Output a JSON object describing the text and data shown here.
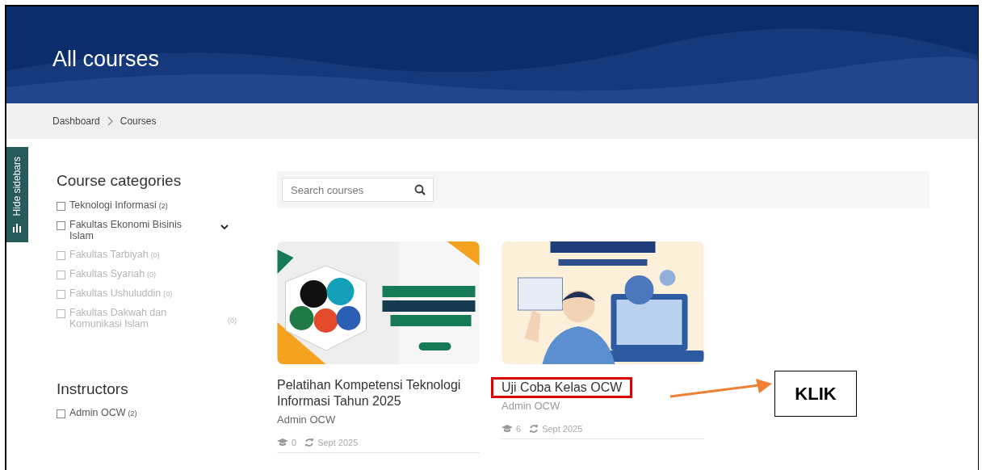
{
  "header": {
    "title": "All courses"
  },
  "breadcrumb": [
    "Dashboard",
    "Courses"
  ],
  "sidebar_toggle": {
    "label": "Hide sidebars"
  },
  "categories": {
    "title": "Course categories",
    "items": [
      {
        "label": "Teknologi Informasi",
        "count": "(2)",
        "checked": false,
        "disabled": false,
        "kind": "leaf"
      },
      {
        "label": "Fakultas Ekonomi Bisinis Islam",
        "checked": false,
        "disabled": false,
        "kind": "parent"
      },
      {
        "label": "Fakultas Tarbiyah",
        "count": "(0)",
        "checked": false,
        "disabled": true,
        "kind": "leaf"
      },
      {
        "label": "Fakultas Syariah",
        "count": "(0)",
        "checked": false,
        "disabled": true,
        "kind": "leaf"
      },
      {
        "label": "Fakultas Ushuluddin",
        "count": "(0)",
        "checked": false,
        "disabled": true,
        "kind": "leaf"
      },
      {
        "label": "Fakultas Dakwah dan Komunikasi Islam",
        "count": "(0)",
        "checked": false,
        "disabled": true,
        "kind": "wide"
      }
    ]
  },
  "instructors": {
    "title": "Instructors",
    "items": [
      {
        "label": "Admin OCW",
        "count": "(2)",
        "checked": false
      }
    ]
  },
  "search": {
    "placeholder": "Search courses"
  },
  "courses": [
    {
      "title": "Pelatihan Kompetensi Teknologi Informasi Tahun 2025",
      "instructor": "Admin OCW",
      "students": "0",
      "updated": "Sept 2025",
      "highlighted": false
    },
    {
      "title": "Uji Coba Kelas OCW",
      "instructor": "Admin OCW",
      "students": "6",
      "updated": "Sept 2025",
      "highlighted": true
    }
  ],
  "annotation": {
    "label": "KLIK"
  }
}
